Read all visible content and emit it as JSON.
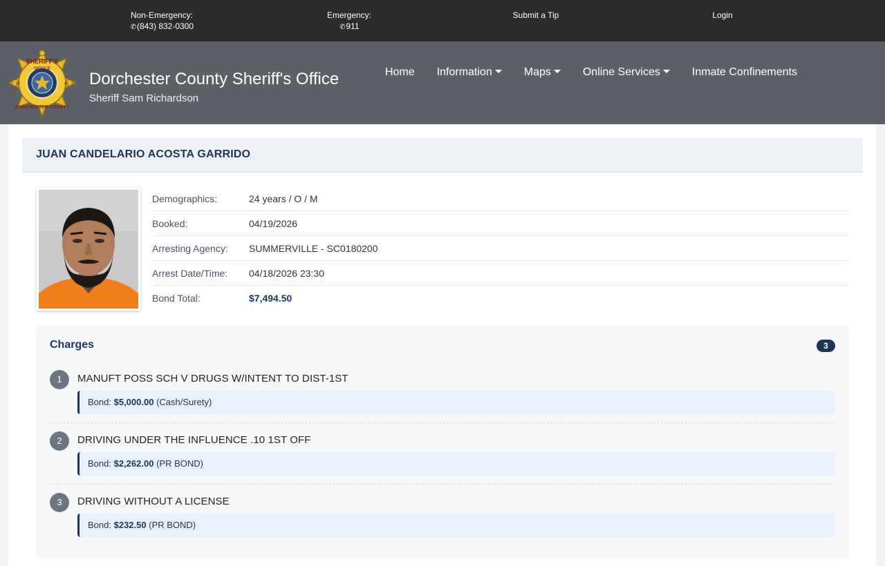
{
  "topbar": {
    "non_emergency_label": "Non-Emergency:",
    "non_emergency_phone": "(843) 832-0300",
    "emergency_label": "Emergency:",
    "emergency_phone": "911",
    "tip_label": "Submit a Tip",
    "login_label": "Login"
  },
  "brand": {
    "title": "Dorchester County Sheriff's Office",
    "subtitle": "Sheriff Sam Richardson",
    "logo_text_top": "SHERIFF'S",
    "logo_text_mid": "OFFICE",
    "logo_text_bottom": "DORCHESTER COUNTY",
    "logo_side_left": "SC",
    "logo_side_right": "SC"
  },
  "nav": {
    "items": [
      {
        "label": "Home",
        "dropdown": false
      },
      {
        "label": "Information",
        "dropdown": true
      },
      {
        "label": "Maps",
        "dropdown": true
      },
      {
        "label": "Online Services",
        "dropdown": true
      },
      {
        "label": "Inmate Confinements",
        "dropdown": false
      }
    ]
  },
  "inmate": {
    "name": "JUAN CANDELARIO ACOSTA GARRIDO",
    "details": [
      {
        "label": "Demographics:",
        "value": "24 years / O / M"
      },
      {
        "label": "Booked:",
        "value": "04/19/2026"
      },
      {
        "label": "Arresting Agency:",
        "value": "SUMMERVILLE - SC0180200"
      },
      {
        "label": "Arrest Date/Time:",
        "value": "04/18/2026 23:30"
      },
      {
        "label": "Bond Total:",
        "value": "$7,494.50"
      }
    ]
  },
  "charges": {
    "title": "Charges",
    "count": "3",
    "bond_prefix": "Bond:",
    "items": [
      {
        "num": "1",
        "desc": "MANUFT POSS SCH V DRUGS W/INTENT TO DIST-1ST",
        "amount": "$5,000.00",
        "type": "(Cash/Surety)"
      },
      {
        "num": "2",
        "desc": "DRIVING UNDER THE INFLUENCE .10 1ST OFF",
        "amount": "$2,262.00",
        "type": "(PR BOND)"
      },
      {
        "num": "3",
        "desc": "DRIVING WITHOUT A LICENSE",
        "amount": "$232.50",
        "type": "(PR BOND)"
      }
    ]
  },
  "colors": {
    "topbar": "#2b2b2b",
    "header": "#5b6167",
    "accent": "#1d3557",
    "bond_bg": "#e6f1fd",
    "badge_gold": "#e7b928"
  }
}
